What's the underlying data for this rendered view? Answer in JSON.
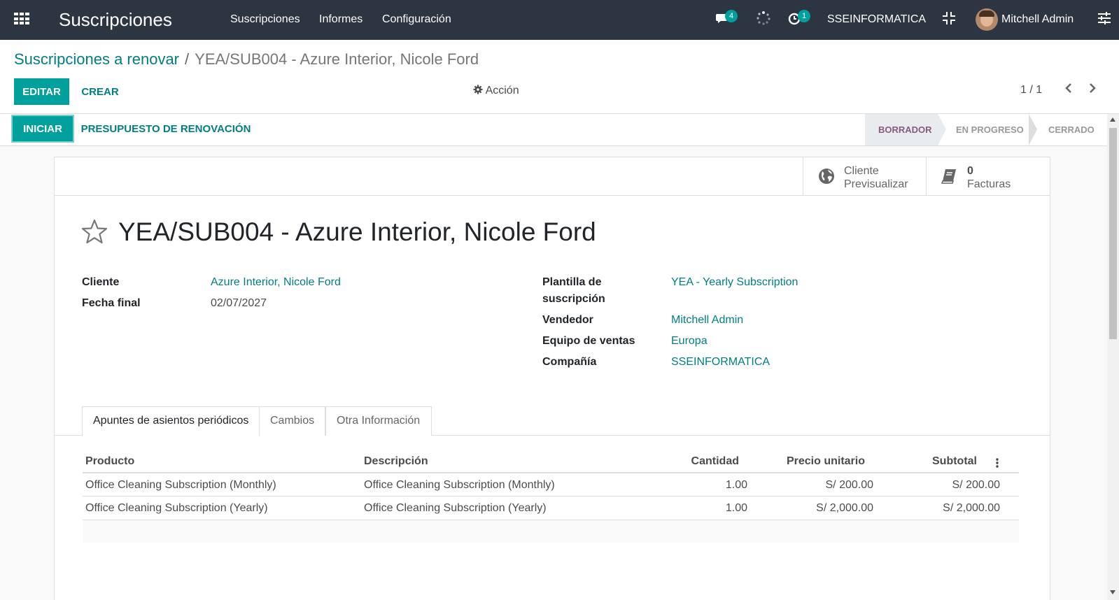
{
  "navbar": {
    "app_title": "Suscripciones",
    "menu": [
      "Suscripciones",
      "Informes",
      "Configuración"
    ],
    "messages_count": "4",
    "activities_count": "1",
    "company": "SSEINFORMATICA",
    "user": "Mitchell Admin"
  },
  "breadcrumb": {
    "parent": "Suscripciones a renovar",
    "separator": "/",
    "current": "YEA/SUB004 - Azure Interior, Nicole Ford"
  },
  "toolbar": {
    "edit_label": "EDITAR",
    "create_label": "CREAR",
    "action_label": "Acción",
    "pager": "1 / 1"
  },
  "statusbar": {
    "start_label": "INICIAR",
    "renewal_label": "PRESUPUESTO DE RENOVACIÓN",
    "stages": [
      "BORRADOR",
      "EN PROGRESO",
      "CERRADO"
    ],
    "active_stage": "BORRADOR"
  },
  "smart_buttons": {
    "customer_line1": "Cliente",
    "customer_line2": "Previsualizar",
    "invoices_count": "0",
    "invoices_label": "Facturas"
  },
  "record": {
    "title": "YEA/SUB004 - Azure Interior, Nicole Ford",
    "customer_label": "Cliente",
    "customer": "Azure Interior, Nicole Ford",
    "end_date_label": "Fecha final",
    "end_date": "02/07/2027",
    "template_label_1": "Plantilla de",
    "template_label_2": "suscripción",
    "template": "YEA - Yearly Subscription",
    "salesperson_label": "Vendedor",
    "salesperson": "Mitchell Admin",
    "sales_team_label": "Equipo de ventas",
    "sales_team": "Europa",
    "company_label": "Compañía",
    "company": "SSEINFORMATICA"
  },
  "tabs": [
    "Apuntes de asientos periódicos",
    "Cambios",
    "Otra Información"
  ],
  "lines": {
    "headers": [
      "Producto",
      "Descripción",
      "Cantidad",
      "Precio unitario",
      "Subtotal"
    ],
    "rows": [
      [
        "Office Cleaning Subscription (Monthly)",
        "Office Cleaning Subscription (Monthly)",
        "1.00",
        "S/ 200.00",
        "S/ 200.00"
      ],
      [
        "Office Cleaning Subscription (Yearly)",
        "Office Cleaning Subscription (Yearly)",
        "1.00",
        "S/ 2,000.00",
        "S/ 2,000.00"
      ]
    ]
  },
  "colors": {
    "navbar": "#2c3541",
    "primary": "#00a09d",
    "link": "#017e84",
    "active_stage": "#875a7b"
  }
}
